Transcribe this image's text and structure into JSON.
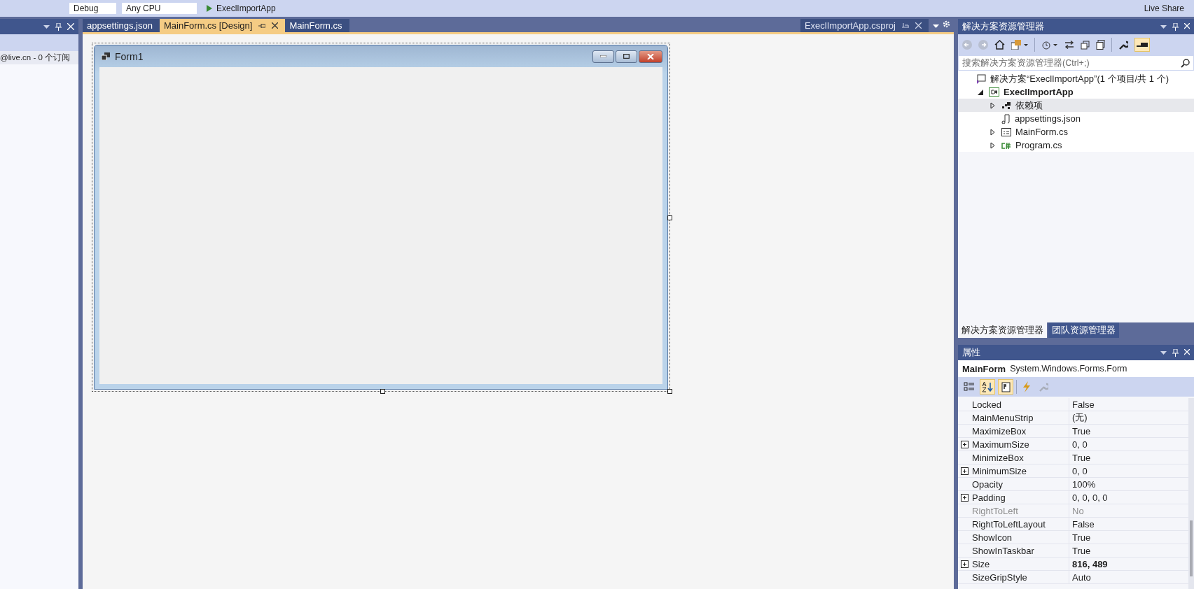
{
  "toolbar": {
    "configuration": "Debug",
    "platform": "Any CPU",
    "start_target": "ExeclImportApp",
    "live_share": "Live Share"
  },
  "left_panel": {
    "account_text": "@live.cn - 0 个订阅"
  },
  "document_tabs": [
    {
      "label": "appsettings.json",
      "selected": false
    },
    {
      "label": "MainForm.cs [Design]",
      "selected": true
    },
    {
      "label": "MainForm.cs",
      "selected": false
    }
  ],
  "preview_tab": {
    "label": "ExeclImportApp.csproj"
  },
  "designer": {
    "form_title": "Form1"
  },
  "solution_explorer": {
    "title": "解决方案资源管理器",
    "search_placeholder": "搜索解决方案资源管理器(Ctrl+;)",
    "tree": [
      {
        "label": "解决方案“ExeclImportApp”(1 个项目/共 1 个)",
        "kind": "solution",
        "selected": false,
        "children": [
          {
            "label": "ExeclImportApp",
            "kind": "project",
            "expanded": true,
            "selected": false,
            "children": [
              {
                "label": "依赖项",
                "kind": "dependencies",
                "expanded": false,
                "selected": true
              },
              {
                "label": "appsettings.json",
                "kind": "json",
                "selected": false
              },
              {
                "label": "MainForm.cs",
                "kind": "form",
                "expanded": false,
                "selected": false
              },
              {
                "label": "Program.cs",
                "kind": "csharp",
                "expanded": false,
                "selected": false
              }
            ]
          }
        ]
      }
    ]
  },
  "bottom_tabs": [
    {
      "label": "解决方案资源管理器",
      "selected": true
    },
    {
      "label": "团队资源管理器",
      "selected": false
    }
  ],
  "properties": {
    "title": "属性",
    "object_name": "MainForm",
    "object_type": "System.Windows.Forms.Form",
    "toolbar_buttons": [
      {
        "kind": "categorized",
        "selected": false
      },
      {
        "kind": "alphabetical",
        "selected": true
      },
      {
        "kind": "properties",
        "selected": true
      },
      {
        "kind": "events",
        "selected": false
      },
      {
        "kind": "property-pages",
        "selected": false
      }
    ],
    "rows": [
      {
        "name": "Locked",
        "value": "False",
        "expandable": false,
        "disabled": false,
        "modified": false
      },
      {
        "name": "MainMenuStrip",
        "value": "(无)",
        "expandable": false,
        "disabled": false,
        "modified": false
      },
      {
        "name": "MaximizeBox",
        "value": "True",
        "expandable": false,
        "disabled": false,
        "modified": false
      },
      {
        "name": "MaximumSize",
        "value": "0, 0",
        "expandable": true,
        "disabled": false,
        "modified": false
      },
      {
        "name": "MinimizeBox",
        "value": "True",
        "expandable": false,
        "disabled": false,
        "modified": false
      },
      {
        "name": "MinimumSize",
        "value": "0, 0",
        "expandable": true,
        "disabled": false,
        "modified": false
      },
      {
        "name": "Opacity",
        "value": "100%",
        "expandable": false,
        "disabled": false,
        "modified": false
      },
      {
        "name": "Padding",
        "value": "0, 0, 0, 0",
        "expandable": true,
        "disabled": false,
        "modified": false
      },
      {
        "name": "RightToLeft",
        "value": "No",
        "expandable": false,
        "disabled": true,
        "modified": false
      },
      {
        "name": "RightToLeftLayout",
        "value": "False",
        "expandable": false,
        "disabled": false,
        "modified": false
      },
      {
        "name": "ShowIcon",
        "value": "True",
        "expandable": false,
        "disabled": false,
        "modified": false
      },
      {
        "name": "ShowInTaskbar",
        "value": "True",
        "expandable": false,
        "disabled": false,
        "modified": false
      },
      {
        "name": "Size",
        "value": "816, 489",
        "expandable": true,
        "disabled": false,
        "modified": true
      },
      {
        "name": "SizeGripStyle",
        "value": "Auto",
        "expandable": false,
        "disabled": false,
        "modified": false
      }
    ]
  }
}
